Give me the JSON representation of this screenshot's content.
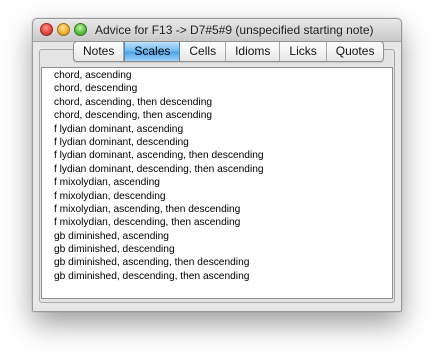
{
  "window": {
    "title": "Advice for F13 -> D7#5#9 (unspecified starting note)"
  },
  "tabs": [
    {
      "label": "Notes",
      "active": false
    },
    {
      "label": "Scales",
      "active": true
    },
    {
      "label": "Cells",
      "active": false
    },
    {
      "label": "Idioms",
      "active": false
    },
    {
      "label": "Licks",
      "active": false
    },
    {
      "label": "Quotes",
      "active": false
    }
  ],
  "list": {
    "items": [
      "chord, ascending",
      "chord, descending",
      "chord, ascending, then descending",
      "chord, descending, then ascending",
      "f lydian dominant, ascending",
      "f lydian dominant, descending",
      "f lydian dominant, ascending, then descending",
      "f lydian dominant, descending, then ascending",
      "f mixolydian, ascending",
      "f mixolydian, descending",
      "f mixolydian, ascending, then descending",
      "f mixolydian, descending, then ascending",
      "gb diminished, ascending",
      "gb diminished, descending",
      "gb diminished, ascending, then descending",
      "gb diminished, descending, then ascending"
    ]
  },
  "colors": {
    "active_tab": "#4aa2e8",
    "close_button": "#e2463d",
    "minimize_button": "#f2b231",
    "zoom_button": "#5fbf41"
  }
}
